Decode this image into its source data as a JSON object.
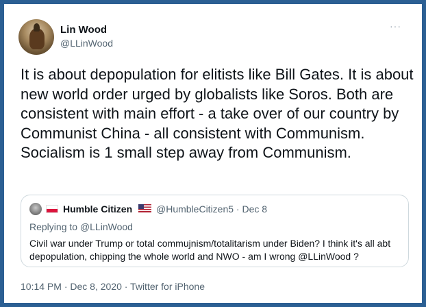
{
  "tweet": {
    "author_name": "Lin Wood",
    "author_handle": "@LLinWood",
    "more_icon": "···",
    "text": "It is about depopulation for elitists like Bill Gates. It is about new world order urged by globalists like Soros. Both are consistent with main effort - a take over of our country by Communist China - all consistent with Communism. Socialism is 1 small step away from Communism.",
    "footer": "10:14 PM · Dec 8, 2020 · Twitter for iPhone"
  },
  "quoted": {
    "author_name": "Humble Citizen",
    "meta": "@HumbleCitizen5 · Dec 8",
    "replying_to": "Replying to @LLinWood",
    "text": "Civil war under Trump or total commujnism/totalitarism under Biden?  I think it's all abt depopulation, chipping the whole world and NWO - am I wrong @LLinWood ?",
    "flags": [
      "poland-flag",
      "usa-flag"
    ]
  },
  "colors": {
    "frame": "#2b5f93",
    "text": "#0f1419",
    "muted": "#536471",
    "border": "#cfd9de"
  }
}
